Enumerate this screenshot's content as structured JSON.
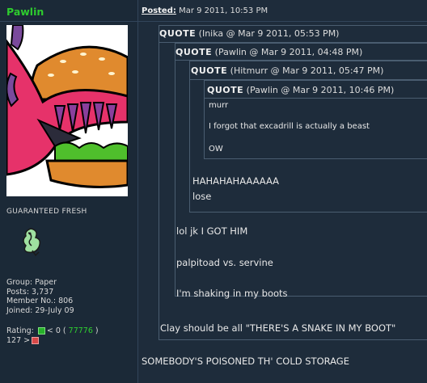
{
  "user": {
    "name": "Pawlin",
    "avatar_caption": "GUARANTEED FRESH",
    "group": "Group: Paper",
    "posts": "Posts: 3,737",
    "member_no": "Member No.: 806",
    "joined": "Joined: 29-July 09",
    "rating_label": "Rating:",
    "rating_value": "< 0 (",
    "rating_score": "77776",
    "rating_close": ")",
    "rating_next": "127 >"
  },
  "post": {
    "posted_label": "Posted:",
    "posted_date": "Mar 9 2011, 10:53 PM",
    "final_line": "SOMEBODY'S POISONED TH' COLD STORAGE"
  },
  "quotes": {
    "label": "QUOTE",
    "q1": {
      "meta": "(Inika @ Mar 9 2011, 05:53 PM)",
      "reply": "Clay should be all \"THERE'S A SNAKE IN MY BOOT\""
    },
    "q2": {
      "meta": "(Pawlin @ Mar 9 2011, 04:48 PM)",
      "lines": [
        "lol jk I GOT HIM",
        "palpitoad vs. servine",
        "I'm shaking in my boots"
      ]
    },
    "q3": {
      "meta": "(Hitmurr @ Mar 9 2011, 05:47 PM)",
      "lines": [
        "HAHAHAHAAAAAA",
        "lose"
      ]
    },
    "q4": {
      "meta": "(Pawlin @ Mar 9 2011, 10:46 PM)",
      "lines": [
        "murr",
        "I forgot that excadrill is actually a beast",
        "OW"
      ]
    }
  },
  "colors": {
    "username": "#2ecc2e",
    "background": "#1d2b3a",
    "rating_positive": "#2fd02f",
    "rating_negative": "#d84848"
  }
}
